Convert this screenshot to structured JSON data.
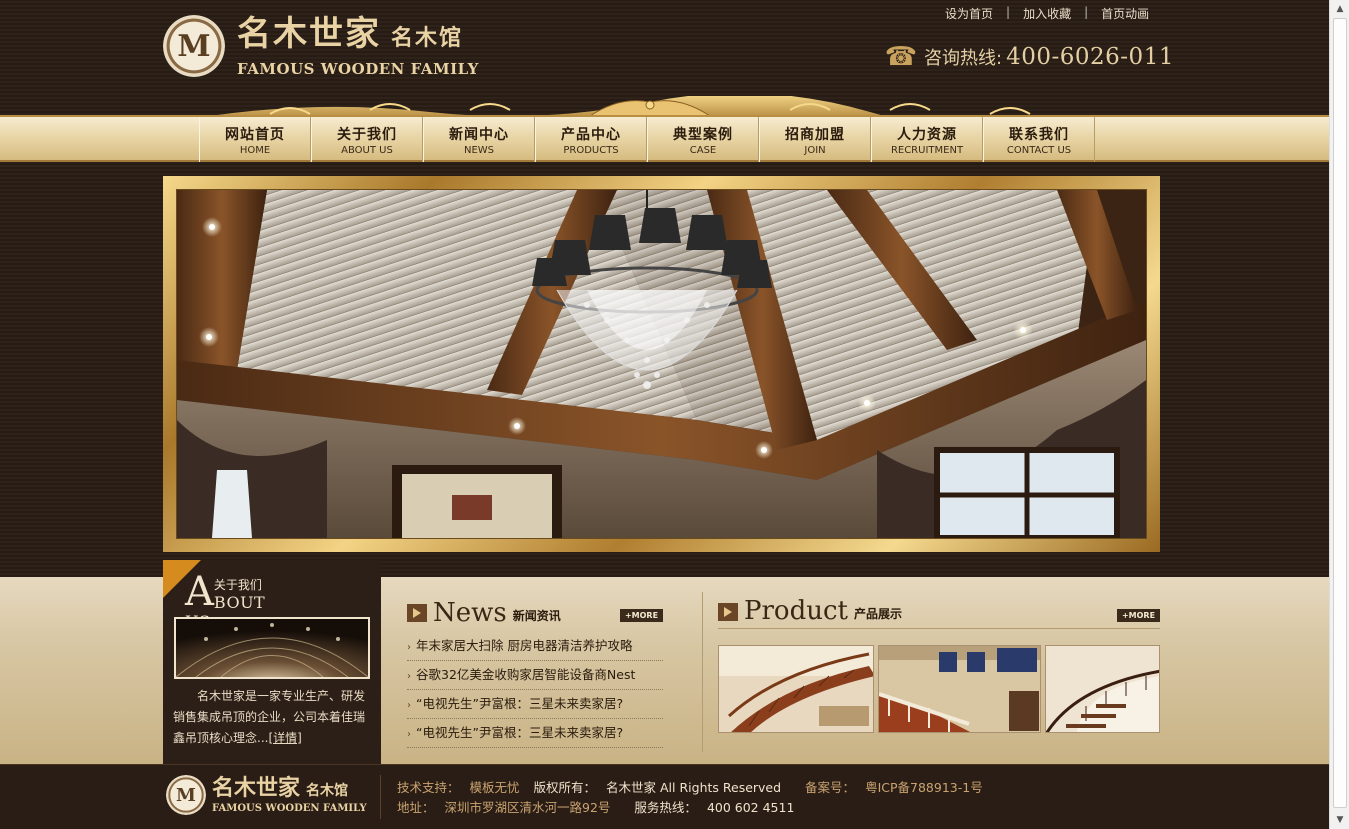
{
  "brand": {
    "emblem_letter": "M",
    "name_cn": "名木世家",
    "name_cn_sub": "名木馆",
    "name_en": "FAMOUS WOODEN FAMILY"
  },
  "toplinks": {
    "set_home": "设为首页",
    "favorite": "加入收藏",
    "home_anim": "首页动画",
    "separator": "|"
  },
  "hotline": {
    "label": "咨询热线:",
    "number": "400-6026-011"
  },
  "nav": [
    {
      "cn": "网站首页",
      "en": "HOME"
    },
    {
      "cn": "关于我们",
      "en": "ABOUT US"
    },
    {
      "cn": "新闻中心",
      "en": "NEWS"
    },
    {
      "cn": "产品中心",
      "en": "PRODUCTS"
    },
    {
      "cn": "典型案例",
      "en": "CASE"
    },
    {
      "cn": "招商加盟",
      "en": "JOIN"
    },
    {
      "cn": "人力资源",
      "en": "RECRUITMENT"
    },
    {
      "cn": "联系我们",
      "en": "CONTACT US"
    }
  ],
  "about": {
    "big_letter": "A",
    "title_cn": "关于我们",
    "title_en": "BOUT US",
    "description": "名木世家是一家专业生产、研发销售集成吊顶的企业，公司本着佳瑞鑫吊顶核心理念...",
    "more": "[详情]"
  },
  "news": {
    "title_en": "News",
    "title_cn": "新闻资讯",
    "more": "+MORE",
    "items": [
      "年末家居大扫除  厨房电器清洁养护攻略",
      "谷歌32亿美金收购家居智能设备商Nest",
      "“电视先生”尹富根：三星未来卖家居?",
      "“电视先生”尹富根：三星未来卖家居?"
    ]
  },
  "product": {
    "title_en": "Product",
    "title_cn": "产品展示",
    "more": "+MORE"
  },
  "footer": {
    "tech_label": "技术支持：",
    "tech_value": "模板无忧",
    "copyright_label": "版权所有：",
    "copyright_value": "名木世家  All Rights Reserved",
    "icp_label": "备案号：",
    "icp_value": "粤ICP备788913-1号",
    "address_label": "地址：",
    "address_value": "深圳市罗湖区清水河一路92号",
    "service_label": "服务热线：",
    "service_value": "400 602 4511"
  },
  "colors": {
    "background": "#2a1e16",
    "gold": "#c9a35e",
    "nav_light": "#f7ecd1",
    "content_band": "#d8c7a4",
    "footer": "#2a1d15",
    "accent_orange": "#d68b1e"
  }
}
